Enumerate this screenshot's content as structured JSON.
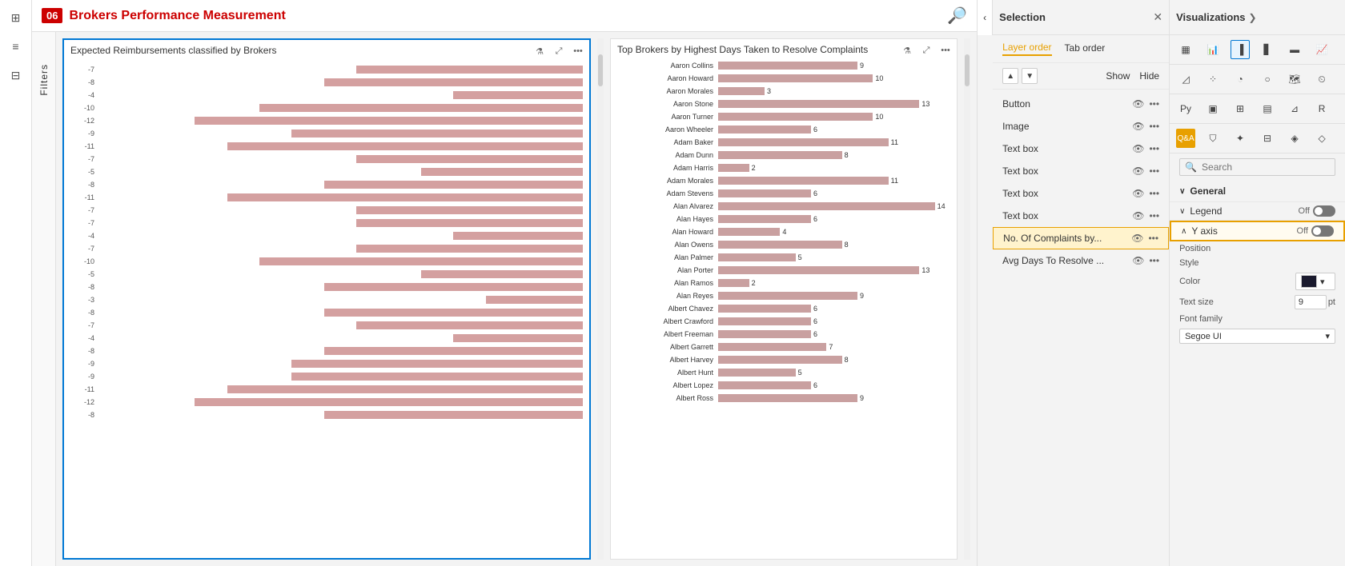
{
  "header": {
    "number": "06",
    "title": "Brokers Performance Measurement",
    "logo": "🔎"
  },
  "leftSidebar": {
    "icons": [
      "grid-icon",
      "table-icon",
      "filter-icon"
    ]
  },
  "filters": {
    "label": "Filters"
  },
  "charts": {
    "left": {
      "title": "Expected Reimbursements classified by Brokers",
      "bars": [
        {
          "value": -7
        },
        {
          "value": -8
        },
        {
          "value": -4
        },
        {
          "value": -10
        },
        {
          "value": -12
        },
        {
          "value": -9
        },
        {
          "value": -11
        },
        {
          "value": -7
        },
        {
          "value": -5
        },
        {
          "value": -8
        },
        {
          "value": -11
        },
        {
          "value": -7
        },
        {
          "value": -7
        },
        {
          "value": -4
        },
        {
          "value": -7
        },
        {
          "value": -10
        },
        {
          "value": -5
        },
        {
          "value": -8
        },
        {
          "value": -3
        },
        {
          "value": -8
        },
        {
          "value": -7
        },
        {
          "value": -4
        },
        {
          "value": -8
        },
        {
          "value": -9
        },
        {
          "value": -9
        },
        {
          "value": -11
        },
        {
          "value": -12
        },
        {
          "value": -8
        }
      ]
    },
    "right": {
      "title": "Top Brokers by Highest Days Taken to Resolve Complaints",
      "brokers": [
        {
          "name": "Aaron Collins",
          "value": 9
        },
        {
          "name": "Aaron Howard",
          "value": 10
        },
        {
          "name": "Aaron Morales",
          "value": 3
        },
        {
          "name": "Aaron Stone",
          "value": 13
        },
        {
          "name": "Aaron Turner",
          "value": 10
        },
        {
          "name": "Aaron Wheeler",
          "value": 6
        },
        {
          "name": "Adam Baker",
          "value": 11
        },
        {
          "name": "Adam Dunn",
          "value": 8
        },
        {
          "name": "Adam Harris",
          "value": 2
        },
        {
          "name": "Adam Morales",
          "value": 11
        },
        {
          "name": "Adam Stevens",
          "value": 6
        },
        {
          "name": "Alan Alvarez",
          "value": 14
        },
        {
          "name": "Alan Hayes",
          "value": 6
        },
        {
          "name": "Alan Howard",
          "value": 4
        },
        {
          "name": "Alan Owens",
          "value": 8
        },
        {
          "name": "Alan Palmer",
          "value": 5
        },
        {
          "name": "Alan Porter",
          "value": 13
        },
        {
          "name": "Alan Ramos",
          "value": 2
        },
        {
          "name": "Alan Reyes",
          "value": 9
        },
        {
          "name": "Albert Chavez",
          "value": 6
        },
        {
          "name": "Albert Crawford",
          "value": 6
        },
        {
          "name": "Albert Freeman",
          "value": 6
        },
        {
          "name": "Albert Garrett",
          "value": 7
        },
        {
          "name": "Albert Harvey",
          "value": 8
        },
        {
          "name": "Albert Hunt",
          "value": 5
        },
        {
          "name": "Albert Lopez",
          "value": 6
        },
        {
          "name": "Albert Ross",
          "value": 9
        }
      ]
    }
  },
  "selectionPanel": {
    "title": "Selection",
    "closeLabel": "✕",
    "expandLabel": "❯",
    "layerOrderTab": "Layer order",
    "tabOrderTab": "Tab order",
    "showLabel": "Show",
    "hideLabel": "Hide",
    "layers": [
      {
        "name": "Button",
        "visible": true
      },
      {
        "name": "Image",
        "visible": true
      },
      {
        "name": "Text box",
        "visible": true
      },
      {
        "name": "Text box",
        "visible": true
      },
      {
        "name": "Text box",
        "visible": true
      },
      {
        "name": "Text box",
        "visible": true
      },
      {
        "name": "No. Of Complaints by...",
        "visible": true,
        "highlighted": true
      },
      {
        "name": "Avg Days To Resolve ...",
        "visible": true
      }
    ]
  },
  "visualizationsPanel": {
    "title": "Visualizations",
    "searchPlaceholder": "Search",
    "sections": {
      "general": {
        "label": "General",
        "expanded": true
      },
      "legend": {
        "label": "Legend",
        "toggle": "Off"
      },
      "yAxis": {
        "label": "Y axis",
        "toggle": "Off",
        "highlighted": true
      }
    },
    "formatRows": {
      "position": {
        "label": "Position"
      },
      "style": {
        "label": "Style"
      },
      "color": {
        "label": "Color"
      },
      "textSize": {
        "label": "Text size",
        "value": "9",
        "unit": "pt"
      },
      "fontFamily": {
        "label": "Font family",
        "value": "Segoe UI"
      }
    }
  }
}
